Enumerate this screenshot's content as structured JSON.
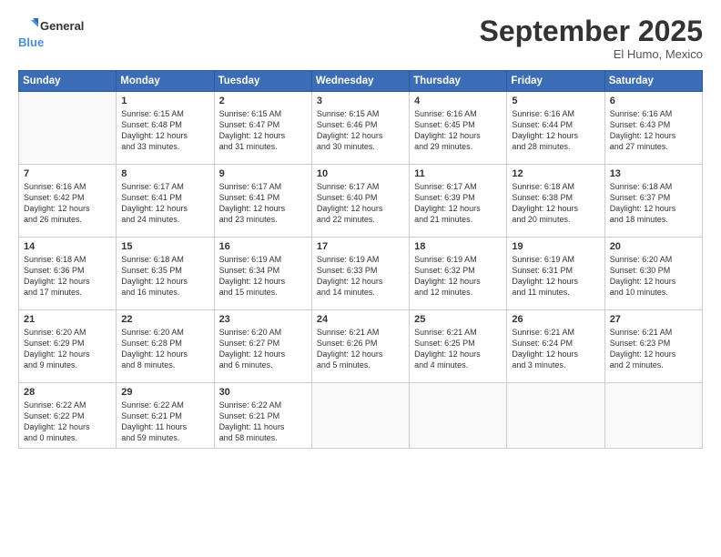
{
  "logo": {
    "line1": "General",
    "line2": "Blue"
  },
  "title": "September 2025",
  "location": "El Humo, Mexico",
  "headers": [
    "Sunday",
    "Monday",
    "Tuesday",
    "Wednesday",
    "Thursday",
    "Friday",
    "Saturday"
  ],
  "weeks": [
    [
      {
        "day": "",
        "content": ""
      },
      {
        "day": "1",
        "content": "Sunrise: 6:15 AM\nSunset: 6:48 PM\nDaylight: 12 hours\nand 33 minutes."
      },
      {
        "day": "2",
        "content": "Sunrise: 6:15 AM\nSunset: 6:47 PM\nDaylight: 12 hours\nand 31 minutes."
      },
      {
        "day": "3",
        "content": "Sunrise: 6:15 AM\nSunset: 6:46 PM\nDaylight: 12 hours\nand 30 minutes."
      },
      {
        "day": "4",
        "content": "Sunrise: 6:16 AM\nSunset: 6:45 PM\nDaylight: 12 hours\nand 29 minutes."
      },
      {
        "day": "5",
        "content": "Sunrise: 6:16 AM\nSunset: 6:44 PM\nDaylight: 12 hours\nand 28 minutes."
      },
      {
        "day": "6",
        "content": "Sunrise: 6:16 AM\nSunset: 6:43 PM\nDaylight: 12 hours\nand 27 minutes."
      }
    ],
    [
      {
        "day": "7",
        "content": "Sunrise: 6:16 AM\nSunset: 6:42 PM\nDaylight: 12 hours\nand 26 minutes."
      },
      {
        "day": "8",
        "content": "Sunrise: 6:17 AM\nSunset: 6:41 PM\nDaylight: 12 hours\nand 24 minutes."
      },
      {
        "day": "9",
        "content": "Sunrise: 6:17 AM\nSunset: 6:41 PM\nDaylight: 12 hours\nand 23 minutes."
      },
      {
        "day": "10",
        "content": "Sunrise: 6:17 AM\nSunset: 6:40 PM\nDaylight: 12 hours\nand 22 minutes."
      },
      {
        "day": "11",
        "content": "Sunrise: 6:17 AM\nSunset: 6:39 PM\nDaylight: 12 hours\nand 21 minutes."
      },
      {
        "day": "12",
        "content": "Sunrise: 6:18 AM\nSunset: 6:38 PM\nDaylight: 12 hours\nand 20 minutes."
      },
      {
        "day": "13",
        "content": "Sunrise: 6:18 AM\nSunset: 6:37 PM\nDaylight: 12 hours\nand 18 minutes."
      }
    ],
    [
      {
        "day": "14",
        "content": "Sunrise: 6:18 AM\nSunset: 6:36 PM\nDaylight: 12 hours\nand 17 minutes."
      },
      {
        "day": "15",
        "content": "Sunrise: 6:18 AM\nSunset: 6:35 PM\nDaylight: 12 hours\nand 16 minutes."
      },
      {
        "day": "16",
        "content": "Sunrise: 6:19 AM\nSunset: 6:34 PM\nDaylight: 12 hours\nand 15 minutes."
      },
      {
        "day": "17",
        "content": "Sunrise: 6:19 AM\nSunset: 6:33 PM\nDaylight: 12 hours\nand 14 minutes."
      },
      {
        "day": "18",
        "content": "Sunrise: 6:19 AM\nSunset: 6:32 PM\nDaylight: 12 hours\nand 12 minutes."
      },
      {
        "day": "19",
        "content": "Sunrise: 6:19 AM\nSunset: 6:31 PM\nDaylight: 12 hours\nand 11 minutes."
      },
      {
        "day": "20",
        "content": "Sunrise: 6:20 AM\nSunset: 6:30 PM\nDaylight: 12 hours\nand 10 minutes."
      }
    ],
    [
      {
        "day": "21",
        "content": "Sunrise: 6:20 AM\nSunset: 6:29 PM\nDaylight: 12 hours\nand 9 minutes."
      },
      {
        "day": "22",
        "content": "Sunrise: 6:20 AM\nSunset: 6:28 PM\nDaylight: 12 hours\nand 8 minutes."
      },
      {
        "day": "23",
        "content": "Sunrise: 6:20 AM\nSunset: 6:27 PM\nDaylight: 12 hours\nand 6 minutes."
      },
      {
        "day": "24",
        "content": "Sunrise: 6:21 AM\nSunset: 6:26 PM\nDaylight: 12 hours\nand 5 minutes."
      },
      {
        "day": "25",
        "content": "Sunrise: 6:21 AM\nSunset: 6:25 PM\nDaylight: 12 hours\nand 4 minutes."
      },
      {
        "day": "26",
        "content": "Sunrise: 6:21 AM\nSunset: 6:24 PM\nDaylight: 12 hours\nand 3 minutes."
      },
      {
        "day": "27",
        "content": "Sunrise: 6:21 AM\nSunset: 6:23 PM\nDaylight: 12 hours\nand 2 minutes."
      }
    ],
    [
      {
        "day": "28",
        "content": "Sunrise: 6:22 AM\nSunset: 6:22 PM\nDaylight: 12 hours\nand 0 minutes."
      },
      {
        "day": "29",
        "content": "Sunrise: 6:22 AM\nSunset: 6:21 PM\nDaylight: 11 hours\nand 59 minutes."
      },
      {
        "day": "30",
        "content": "Sunrise: 6:22 AM\nSunset: 6:21 PM\nDaylight: 11 hours\nand 58 minutes."
      },
      {
        "day": "",
        "content": ""
      },
      {
        "day": "",
        "content": ""
      },
      {
        "day": "",
        "content": ""
      },
      {
        "day": "",
        "content": ""
      }
    ]
  ]
}
